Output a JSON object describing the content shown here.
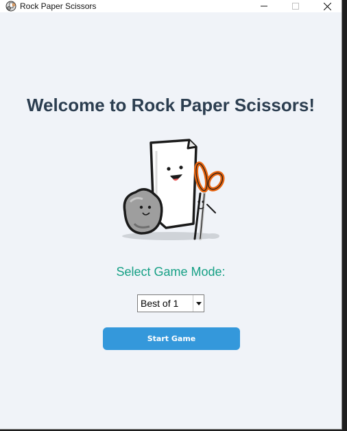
{
  "window": {
    "title": "Rock Paper Scissors",
    "icon": "rock-paper-scissors-app-icon"
  },
  "main": {
    "headline": "Welcome to Rock Paper Scissors!",
    "illustration": "rock-paper-scissors-cartoon",
    "mode_label": "Select Game Mode:",
    "mode_select": {
      "value": "Best of 1"
    },
    "start_button": "Start Game"
  },
  "colors": {
    "background": "#f0f3f8",
    "headline": "#2c3e50",
    "mode_label": "#16a085",
    "button": "#3498db",
    "button_text": "#ffffff"
  }
}
